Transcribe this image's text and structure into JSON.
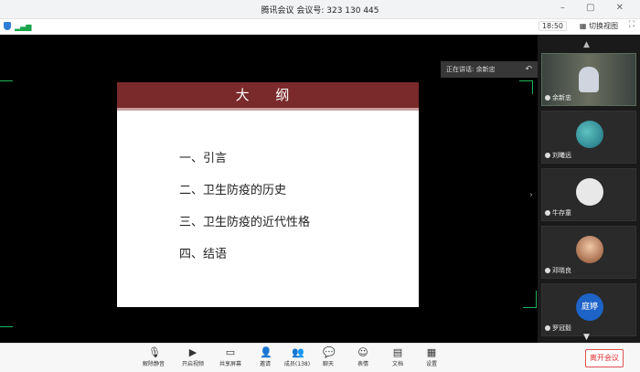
{
  "titlebar": {
    "title": "腾讯会议  会议号: 323 130 445"
  },
  "statusbar": {
    "time": "18:50",
    "switch_view": "切换视图"
  },
  "slide": {
    "heading": "大 纲",
    "items": [
      "一、引言",
      "二、卫生防疫的历史",
      "三、卫生防疫的近代性格",
      "四、结语"
    ]
  },
  "speaking": {
    "text": "正在讲话: 余新忠"
  },
  "participants": [
    {
      "name": "余新忠"
    },
    {
      "name": "刘曦远"
    },
    {
      "name": "牛存童"
    },
    {
      "name": "邓晓良"
    },
    {
      "name": "罗冠毅",
      "avatar_text": "庭婷"
    }
  ],
  "toolbar": {
    "unmute": "解除静音",
    "video": "开启视频",
    "share": "共享屏幕",
    "invite": "邀请",
    "members": "成员(138)",
    "chat": "聊天",
    "reactions": "表情",
    "docs": "文档",
    "settings": "设置",
    "leave": "离开会议"
  },
  "colors": {
    "slide_header": "#7a2a2a",
    "accent_green": "#1fb35a",
    "leave_red": "#e03030"
  }
}
